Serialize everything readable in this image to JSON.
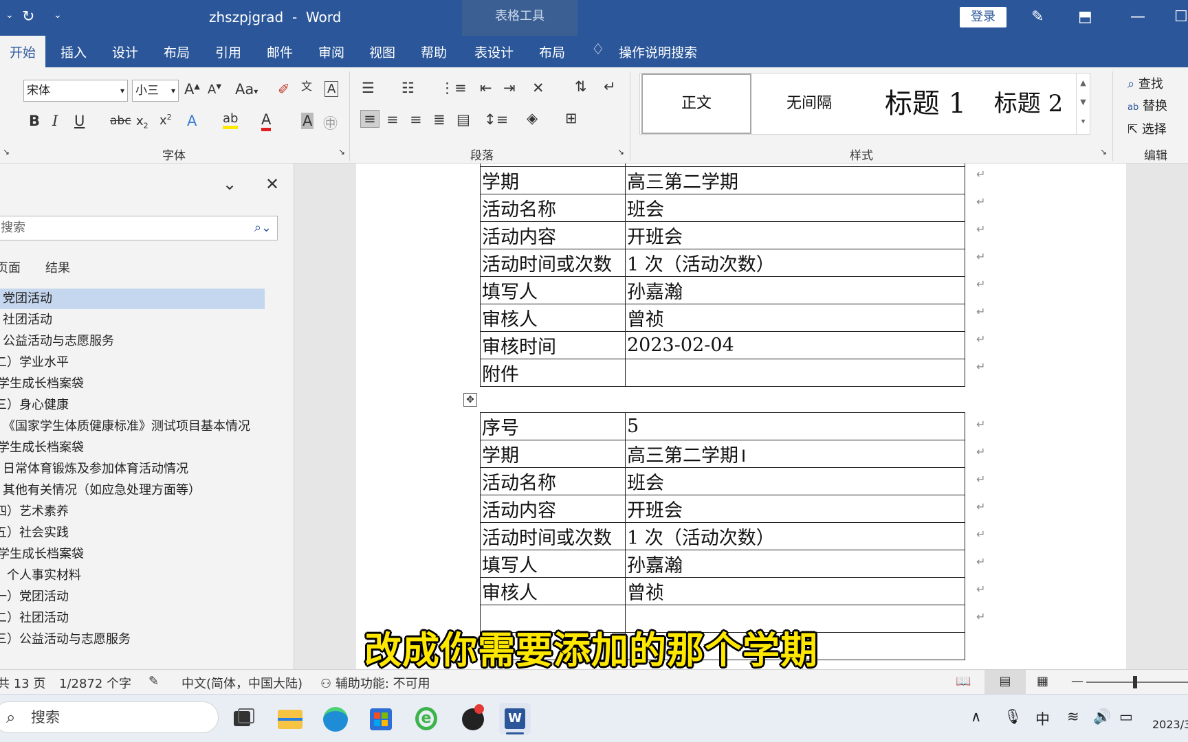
{
  "titlebar": {
    "doc_name": "zhszpjgrad",
    "sep": "-",
    "app_name": "Word",
    "context_tools": "表格工具",
    "login": "登录"
  },
  "tabs": [
    "开始",
    "插入",
    "设计",
    "布局",
    "引用",
    "邮件",
    "审阅",
    "视图",
    "帮助",
    "表设计",
    "布局"
  ],
  "tell_me": "操作说明搜索",
  "ribbon": {
    "font_name": "宋体",
    "font_size": "小三",
    "group_font": "字体",
    "group_paragraph": "段落",
    "group_styles": "样式",
    "group_edit": "编辑",
    "styles": [
      "正文",
      "无间隔",
      "标题 1",
      "标题 2"
    ],
    "find": "查找",
    "replace": "替换",
    "select": "选择"
  },
  "nav": {
    "search_placeholder": "搜索",
    "tab_pages": "页面",
    "tab_results": "结果",
    "items": [
      "党团活动",
      "社团活动",
      "公益活动与志愿服务",
      "二）学业水平",
      "学生成长档案袋",
      "三）身心健康",
      "《国家学生体质健康标准》测试项目基本情况",
      "学生成长档案袋",
      "日常体育锻炼及参加体育活动情况",
      "其他有关情况（如应急处理方面等）",
      "四）艺术素养",
      "五）社会实践",
      "学生成长档案袋",
      "个人事实材料",
      "一）党团活动",
      "二）社团活动",
      "三）公益活动与志愿服务"
    ]
  },
  "table1": [
    [
      "学期",
      "高三第二学期"
    ],
    [
      "活动名称",
      "班会"
    ],
    [
      "活动内容",
      "开班会"
    ],
    [
      "活动时间或次数",
      "1 次（活动次数）"
    ],
    [
      "填写人",
      "孙嘉瀚"
    ],
    [
      "审核人",
      "曾祯"
    ],
    [
      "审核时间",
      "2023-02-04"
    ],
    [
      "附件",
      ""
    ]
  ],
  "table2": [
    [
      "序号",
      "5"
    ],
    [
      "学期",
      "高三第二学期"
    ],
    [
      "活动名称",
      "班会"
    ],
    [
      "活动内容",
      "开班会"
    ],
    [
      "活动时间或次数",
      "1 次（活动次数）"
    ],
    [
      "填写人",
      "孙嘉瀚"
    ],
    [
      "审核人",
      "曾祯"
    ]
  ],
  "subtitle": "改成你需要添加的那个学期",
  "status": {
    "pages": "共 13 页",
    "words": "1/2872 个字",
    "language": "中文(简体，中国大陆)",
    "accessibility": "辅助功能: 不可用"
  },
  "taskbar": {
    "search": "搜索",
    "ime": "中",
    "date": "2023/3"
  },
  "colors": {
    "word_blue": "#2b579a",
    "subtitle_yellow": "#ffe800",
    "nav_selected": "#c5d7ef"
  }
}
